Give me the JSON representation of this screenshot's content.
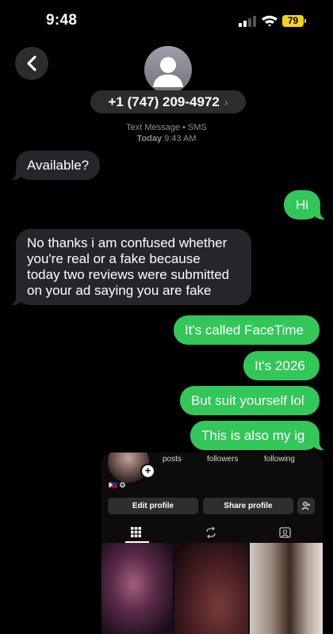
{
  "status": {
    "time": "9:48",
    "battery": "79"
  },
  "header": {
    "contact": "+1 (747) 209-4972",
    "chevron": "›",
    "service_line": "Text Message • SMS",
    "timestamp_day": "Today",
    "timestamp_time": "9:43 AM"
  },
  "messages": [
    {
      "from": "them",
      "text": "Available?"
    },
    {
      "from": "me",
      "text": "Hi"
    },
    {
      "from": "them",
      "lines": [
        "No thanks i am confused whether",
        "you're real or a fake because",
        "today two reviews were submitted",
        "on your ad saying you are fake"
      ]
    },
    {
      "from": "me",
      "text": "It's called FaceTime"
    },
    {
      "from": "me",
      "text": "It's 2026"
    },
    {
      "from": "me",
      "text": "But suit yourself lol"
    },
    {
      "from": "me",
      "text": "This is also my ig"
    }
  ],
  "ig_profile": {
    "stats": [
      "posts",
      "followers",
      "following"
    ],
    "flags": "🇵🇭 ❂",
    "edit_label": "Edit profile",
    "share_label": "Share profile",
    "icons": [
      "grid-icon",
      "reels-icon",
      "tagged-icon",
      "add-person-icon"
    ]
  },
  "colors": {
    "incoming": "#26252a",
    "outgoing": "#33c759",
    "battery": "#f2d21a"
  }
}
